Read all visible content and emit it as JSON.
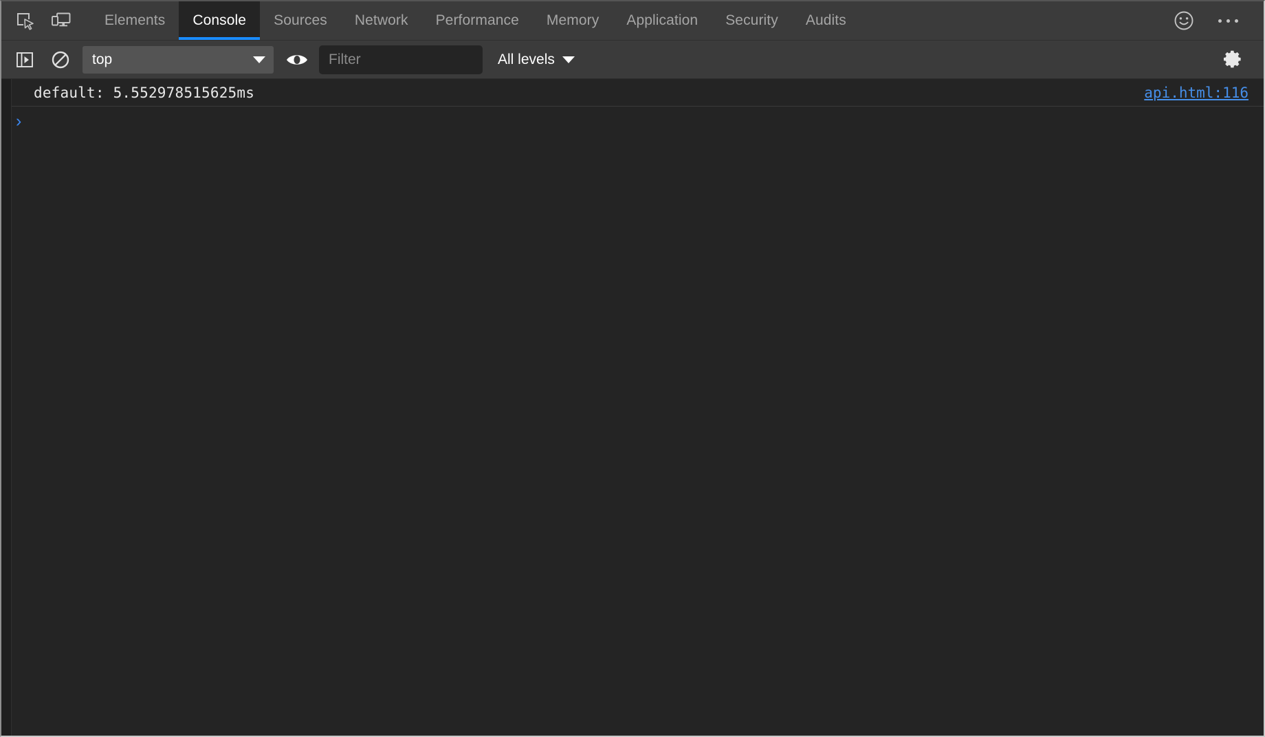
{
  "window": {
    "app": "Chrome DevTools"
  },
  "tabbar": {
    "inspect_icon": "inspect-element-icon",
    "device_icon": "device-toolbar-icon",
    "tabs": [
      {
        "label": "Elements",
        "active": false
      },
      {
        "label": "Console",
        "active": true
      },
      {
        "label": "Sources",
        "active": false
      },
      {
        "label": "Network",
        "active": false
      },
      {
        "label": "Performance",
        "active": false
      },
      {
        "label": "Memory",
        "active": false
      },
      {
        "label": "Application",
        "active": false
      },
      {
        "label": "Security",
        "active": false
      },
      {
        "label": "Audits",
        "active": false
      }
    ],
    "feedback_icon": "smiley-face-icon",
    "more_icon": "more-options-icon",
    "active_tab_accent": "#1a8cff"
  },
  "toolbar": {
    "sidebar_toggle_icon": "console-sidebar-toggle-icon",
    "clear_icon": "clear-console-icon",
    "context": {
      "value": "top",
      "caret_icon": "chevron-down-icon"
    },
    "live_expression_icon": "eye-icon",
    "filter": {
      "value": "",
      "placeholder": "Filter"
    },
    "levels": {
      "value": "All levels",
      "caret_icon": "chevron-down-icon"
    },
    "settings_icon": "gear-icon"
  },
  "console": {
    "messages": [
      {
        "text": "default: 5.552978515625ms",
        "source": "api.html:116",
        "link_color": "#468fea"
      }
    ],
    "prompt": {
      "chevron": "›",
      "value": "",
      "chevron_color": "#3b87f0"
    }
  }
}
